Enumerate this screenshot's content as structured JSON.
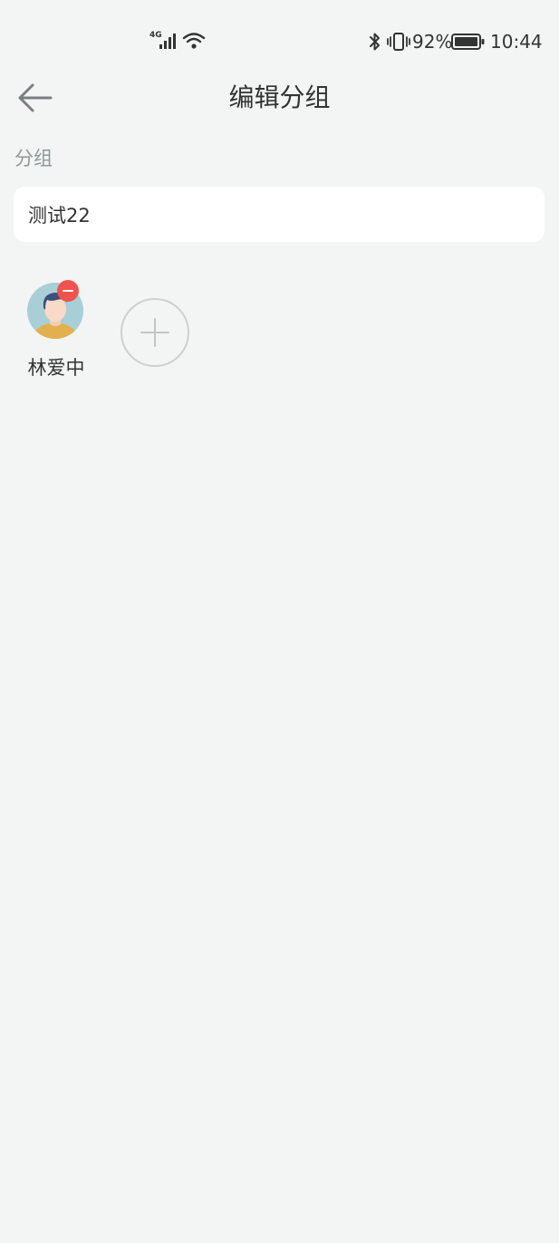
{
  "status_bar": {
    "network_label": "4G",
    "battery_percent": "92%",
    "time": "10:44"
  },
  "header": {
    "title": "编辑分组",
    "back_icon": "arrow-left-icon"
  },
  "group": {
    "section_label": "分组",
    "name_value": "测试22",
    "name_placeholder": ""
  },
  "members": [
    {
      "name": "林爱中",
      "avatar_icon": "user-avatar-icon",
      "remove_icon": "minus-circle-icon"
    }
  ],
  "add_member_icon": "plus-icon",
  "colors": {
    "background": "#f3f4f4",
    "card": "#ffffff",
    "remove_badge": "#ef5350",
    "section_label": "#8e9898",
    "text": "#333333"
  }
}
